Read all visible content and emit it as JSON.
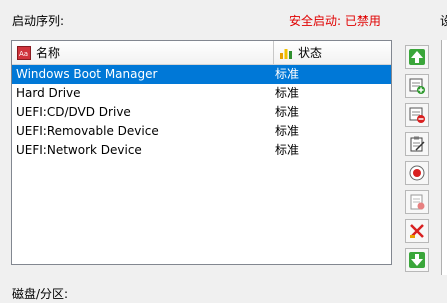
{
  "boot_order_label": "启动序列:",
  "secure_boot": "安全启动: 已禁用",
  "edge_char": "设",
  "columns": {
    "name": "名称",
    "status": "状态"
  },
  "entries": [
    {
      "name": "Windows Boot Manager",
      "status": "标准",
      "selected": true
    },
    {
      "name": "Hard Drive",
      "status": "标准"
    },
    {
      "name": "UEFI:CD/DVD Drive",
      "status": "标准"
    },
    {
      "name": "UEFI:Removable Device",
      "status": "标准"
    },
    {
      "name": "UEFI:Network Device",
      "status": "标准"
    }
  ],
  "toolbar_icons": [
    "move-up-icon",
    "add-entry-icon",
    "delete-entry-icon",
    "edit-entry-icon",
    "set-default-icon",
    "disabled-entry-icon",
    "remove-entry-icon",
    "move-down-icon"
  ],
  "disk_partition_label": "磁盘/分区:",
  "colors": {
    "selection": "#0078d7",
    "secure_text": "#e00000",
    "list_border": "#828790"
  }
}
